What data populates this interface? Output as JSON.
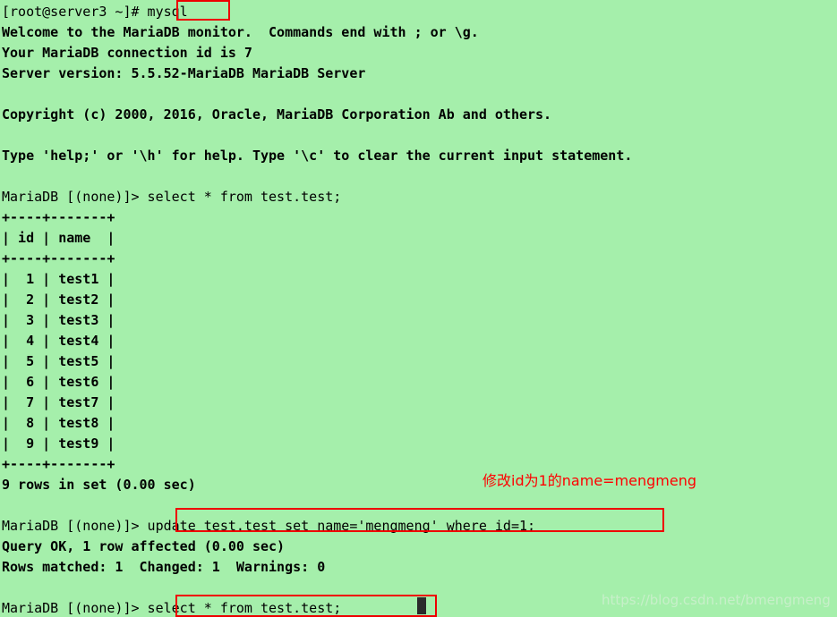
{
  "terminal": {
    "background_color": "#a5efab",
    "text_color": "#000000",
    "highlight_color": "#ee0000",
    "annotation_color": "#ff0000",
    "watermark_color": "#c9f0cb",
    "lines": [
      {
        "text": "[root@server3 ~]# mysql",
        "weight": "normal"
      },
      {
        "text": "Welcome to the MariaDB monitor.  Commands end with ; or \\g.",
        "weight": "bold"
      },
      {
        "text": "Your MariaDB connection id is 7",
        "weight": "bold"
      },
      {
        "text": "Server version: 5.5.52-MariaDB MariaDB Server",
        "weight": "bold"
      },
      {
        "text": "",
        "weight": "bold"
      },
      {
        "text": "Copyright (c) 2000, 2016, Oracle, MariaDB Corporation Ab and others.",
        "weight": "bold"
      },
      {
        "text": "",
        "weight": "bold"
      },
      {
        "text": "Type 'help;' or '\\h' for help. Type '\\c' to clear the current input statement.",
        "weight": "bold"
      },
      {
        "text": "",
        "weight": "bold"
      },
      {
        "text": "MariaDB [(none)]> select * from test.test;",
        "weight": "normal"
      },
      {
        "text": "+----+-------+",
        "weight": "bold"
      },
      {
        "text": "| id | name  |",
        "weight": "bold"
      },
      {
        "text": "+----+-------+",
        "weight": "bold"
      },
      {
        "text": "|  1 | test1 |",
        "weight": "bold"
      },
      {
        "text": "|  2 | test2 |",
        "weight": "bold"
      },
      {
        "text": "|  3 | test3 |",
        "weight": "bold"
      },
      {
        "text": "|  4 | test4 |",
        "weight": "bold"
      },
      {
        "text": "|  5 | test5 |",
        "weight": "bold"
      },
      {
        "text": "|  6 | test6 |",
        "weight": "bold"
      },
      {
        "text": "|  7 | test7 |",
        "weight": "bold"
      },
      {
        "text": "|  8 | test8 |",
        "weight": "bold"
      },
      {
        "text": "|  9 | test9 |",
        "weight": "bold"
      },
      {
        "text": "+----+-------+",
        "weight": "bold"
      },
      {
        "text": "9 rows in set (0.00 sec)",
        "weight": "bold"
      },
      {
        "text": "",
        "weight": "bold"
      },
      {
        "text": "MariaDB [(none)]> update test.test set name='mengmeng' where id=1;",
        "weight": "normal"
      },
      {
        "text": "Query OK, 1 row affected (0.00 sec)",
        "weight": "bold"
      },
      {
        "text": "Rows matched: 1  Changed: 1  Warnings: 0",
        "weight": "bold"
      },
      {
        "text": "",
        "weight": "bold"
      },
      {
        "text": "MariaDB [(none)]> select * from test.test;",
        "weight": "normal"
      }
    ],
    "command_prompt_root": "[root@server3 ~]#",
    "command_mysql": "mysql",
    "command_update": "update test.test set name='mengmeng' where id=1;",
    "command_select": "select * from test.test;"
  },
  "annotation": {
    "text": "修改id为1的name=mengmeng"
  },
  "watermark": {
    "text": "https://blog.csdn.net/bmengmeng"
  },
  "table_data": {
    "columns": [
      "id",
      "name"
    ],
    "rows": [
      [
        "1",
        "test1"
      ],
      [
        "2",
        "test2"
      ],
      [
        "3",
        "test3"
      ],
      [
        "4",
        "test4"
      ],
      [
        "5",
        "test5"
      ],
      [
        "6",
        "test6"
      ],
      [
        "7",
        "test7"
      ],
      [
        "8",
        "test8"
      ],
      [
        "9",
        "test9"
      ]
    ],
    "row_count_text": "9 rows in set (0.00 sec)"
  }
}
